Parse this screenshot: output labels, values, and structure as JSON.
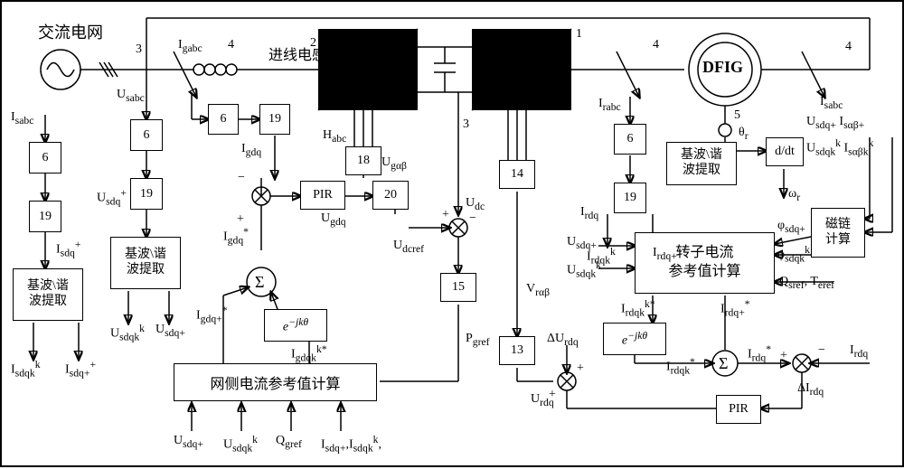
{
  "labels": {
    "grid": "交流电网",
    "inductor": "进线电感",
    "dfig": "DFIG",
    "block6": "6",
    "block19": "19",
    "block18": "18",
    "block20": "20",
    "block14": "14",
    "block15": "15",
    "block13": "13",
    "block5": "5",
    "block4": "4",
    "block3": "3",
    "block1": "1",
    "block2": "2",
    "pir": "PIR",
    "sigma": "Σ",
    "ejk": "e^{−jkθ}",
    "harm_extract": "基波\\谐\n波提取",
    "rotor_ref": "转子电流\n参考值计算",
    "grid_ref": "网侧电流参考值计算",
    "flux_calc": "磁链\n计算",
    "ddt": "d/dt"
  },
  "signals": {
    "Isabc": "I_{sabc}",
    "Isdq": "I_{sdq}^{+}",
    "Isdqk_k": "I_{sdqk}^{k}",
    "Isdq_p": "I_{sdq+}^{+}",
    "Usabc": "U_{sabc}",
    "Igabc": "I_{gabc}",
    "Usdq": "U_{sdq}^{+}",
    "Usdqk_k": "U_{sdqk}^{k}",
    "Usdq_p": "U_{sdq+}",
    "Igdq": "I_{gdq}",
    "Igdq_star": "I_{gdq}^{*}",
    "Igdqp_star": "I_{gdq+}^{*}",
    "Igdqk_star": "I_{gdqk}^{k*}",
    "Ugdq": "U_{gdq}",
    "Ugab": "U_{gαβ}",
    "Habc": "H_{abc}",
    "Udc": "U_{dc}",
    "Udcref": "U_{dcref}",
    "Pgref": "P_{gref}",
    "Qgref": "Q_{gref}",
    "Irabc": "I_{rabc}",
    "Irdq": "I_{rdq}",
    "Irdq_p": "I_{rdq+}",
    "Irdqk_k": "I_{rdqk}^{k}",
    "Irdq_star": "I_{rdq}^{*}",
    "Irdqp_star": "I_{rdq+}^{*}",
    "Irdqk_star": "I_{rdqk}^{k*}",
    "dIrdq": "ΔI_{rdq}",
    "Urdq": "U_{rdq}",
    "dUrdq": "ΔU_{rdq}",
    "Vrab": "V_{rαβ}",
    "theta_r": "θ_{r}",
    "omega_r": "ω_{r}",
    "psi_sdqp": "φ_{sdq+}",
    "psi_sdqk": "φ_{sdqk}^{k}",
    "Qsref": "Q_{sref}",
    "Teref": "T_{eref}",
    "Usdqp_r": "U_{sdq+}",
    "Usdqk_r": "U_{sdqk}^{k}",
    "Iabp": "I_{sαβ+}",
    "Iabk": "I_{sαβk}^{k}",
    "plus": "+",
    "minus": "−"
  }
}
